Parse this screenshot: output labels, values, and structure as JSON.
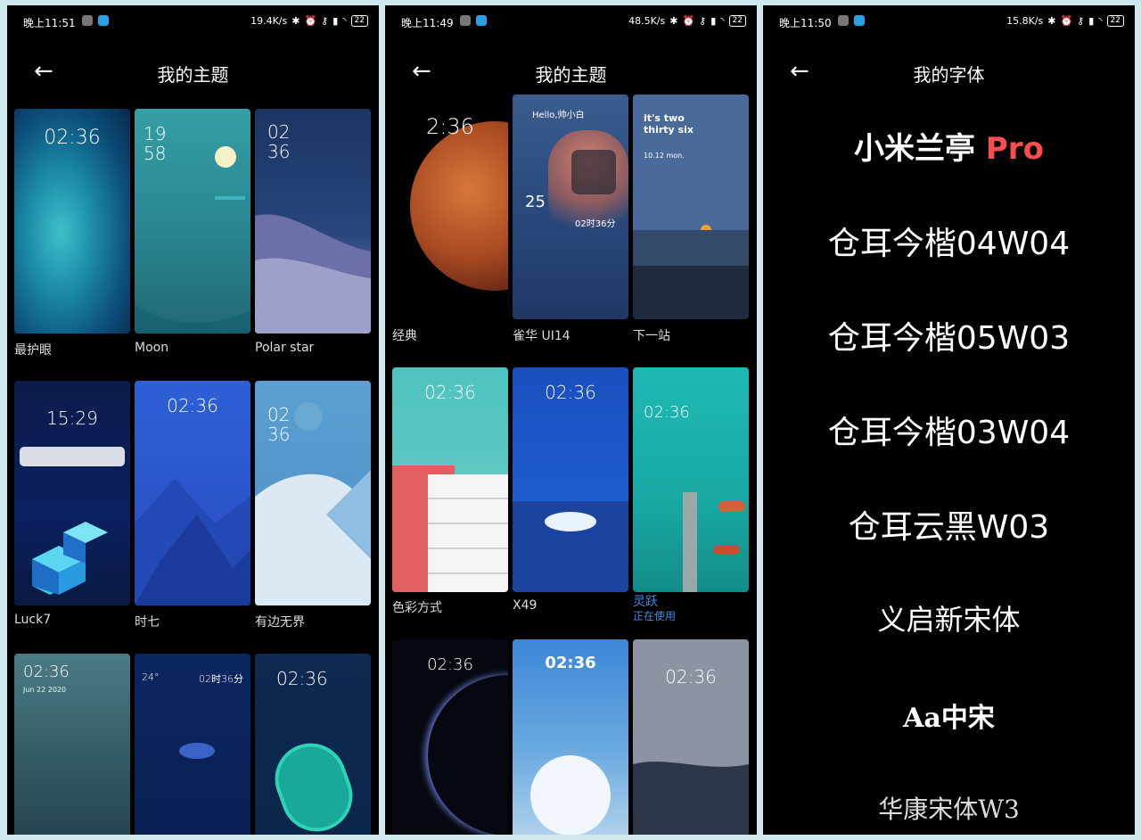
{
  "screens": [
    {
      "status": {
        "time": "晚上11:51",
        "speed": "19.4K/s",
        "battery": "22"
      },
      "title": "我的主题",
      "themes": [
        {
          "name": "最护眼",
          "clock": "02:36"
        },
        {
          "name": "Moon",
          "clock_h": "19",
          "clock_m": "58"
        },
        {
          "name": "Polar star",
          "clock_h": "02",
          "clock_m": "36"
        },
        {
          "name": "Luck7",
          "clock": "15:29"
        },
        {
          "name": "时七",
          "clock": "02:36"
        },
        {
          "name": "有边无界",
          "clock_h": "02",
          "clock_m": "36"
        },
        {
          "name": "",
          "clock": "02:36",
          "date": "Jun 22 2020"
        },
        {
          "name": "",
          "clock": "24°",
          "clock2": "02时36分"
        },
        {
          "name": "",
          "clock": "02:36"
        }
      ]
    },
    {
      "status": {
        "time": "晚上11:49",
        "speed": "48.5K/s",
        "battery": "22"
      },
      "title": "我的主题",
      "themes": [
        {
          "name": "经典",
          "clock": "2:36"
        },
        {
          "name": "雀华 UI14",
          "greeting": "Hello,帅小白",
          "day": "25",
          "clock": "02时36分"
        },
        {
          "name": "下一站",
          "text": "it's two thirty six",
          "date": "10.12 mon."
        },
        {
          "name": "色彩方式",
          "clock": "02:36"
        },
        {
          "name": "X49",
          "clock": "02:36"
        },
        {
          "name": "灵跃",
          "status": "正在使用",
          "clock": "02:36"
        },
        {
          "name": "",
          "clock": "02:36"
        },
        {
          "name": "",
          "clock": "02:36"
        },
        {
          "name": "",
          "clock": "02:36"
        }
      ]
    },
    {
      "status": {
        "time": "晚上11:50",
        "speed": "15.8K/s",
        "battery": "22"
      },
      "title": "我的字体",
      "fonts": [
        {
          "name": "小米兰亭",
          "suffix": "Pro"
        },
        {
          "name": "仓耳今楷04W04"
        },
        {
          "name": "仓耳今楷05W03"
        },
        {
          "name": "仓耳今楷03W04"
        },
        {
          "name": "仓耳云黑W03"
        },
        {
          "name": "义启新宋体"
        },
        {
          "name": "Aa中宋"
        },
        {
          "name": "华康宋体W3"
        }
      ]
    }
  ],
  "colors": {
    "accent": "#3c8ce7",
    "pro": "#ff4d4d",
    "frame": "#cfe8f0"
  },
  "icons": [
    "back-arrow-icon",
    "bluetooth-icon",
    "alarm-icon",
    "key-icon",
    "signal-icon",
    "wifi-icon",
    "battery-icon"
  ]
}
